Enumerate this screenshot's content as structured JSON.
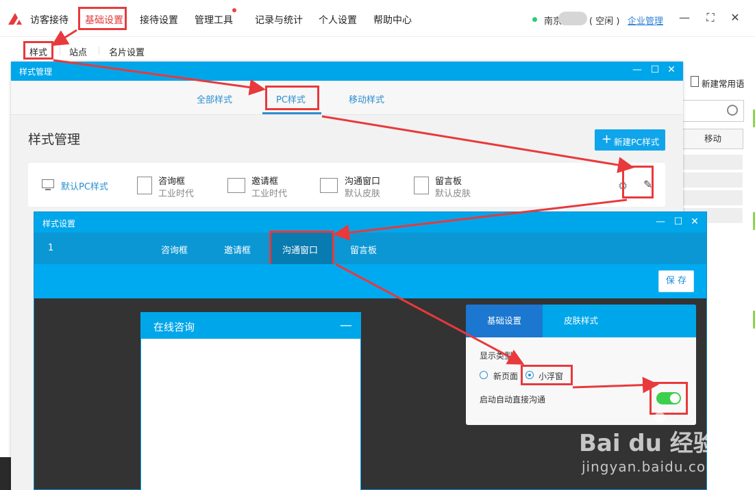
{
  "topbar": {
    "app_title": "访客接待",
    "nav": [
      "基础设置",
      "接待设置",
      "管理工具",
      "记录与统计",
      "个人设置",
      "帮助中心"
    ],
    "status_user": "南京",
    "status_state": "( 空闲 )",
    "enterprise_link": "企业管理",
    "controls": {
      "min": "—",
      "max": "⛶",
      "close": "✕"
    }
  },
  "subnav": {
    "items": [
      "样式",
      "站点",
      "名片设置"
    ]
  },
  "background_panel": {
    "new_phrase": "新建常用语",
    "move": "移动"
  },
  "style_manager": {
    "window_title": "样式管理",
    "tabs": [
      "全部样式",
      "PC样式",
      "移动样式"
    ],
    "heading": "样式管理",
    "new_button": "新建PC样式",
    "row": {
      "default_label": "默认PC样式",
      "components": [
        {
          "name": "咨询框",
          "value": "工业时代"
        },
        {
          "name": "邀请框",
          "value": "工业时代"
        },
        {
          "name": "沟通窗口",
          "value": "默认皮肤"
        },
        {
          "name": "留言板",
          "value": "默认皮肤"
        }
      ],
      "edit_icon": "pencil-icon",
      "share_icon": "share-icon"
    }
  },
  "style_settings": {
    "window_title": "样式设置",
    "number": "1",
    "tabs": [
      "咨询框",
      "邀请框",
      "沟通窗口",
      "留言板"
    ],
    "active_tab": "沟通窗口",
    "save_button": "保 存",
    "preview": {
      "title": "在线咨询",
      "minimize": "—"
    },
    "panel": {
      "tabs": [
        "基础设置",
        "皮肤样式"
      ],
      "display_type_label": "显示类型",
      "radio_options": [
        "新页面",
        "小浮窗"
      ],
      "selected_option": "小浮窗",
      "auto_chat_label": "启动自动直接沟通",
      "auto_chat_enabled": true
    }
  },
  "colors": {
    "accent": "#00a6ea",
    "highlight": "#e8393c",
    "toggle_on": "#3ccf4e",
    "link": "#2a8ed0"
  },
  "watermark": {
    "brand": "Bai du 经验",
    "url": "jingyan.baidu.com"
  }
}
